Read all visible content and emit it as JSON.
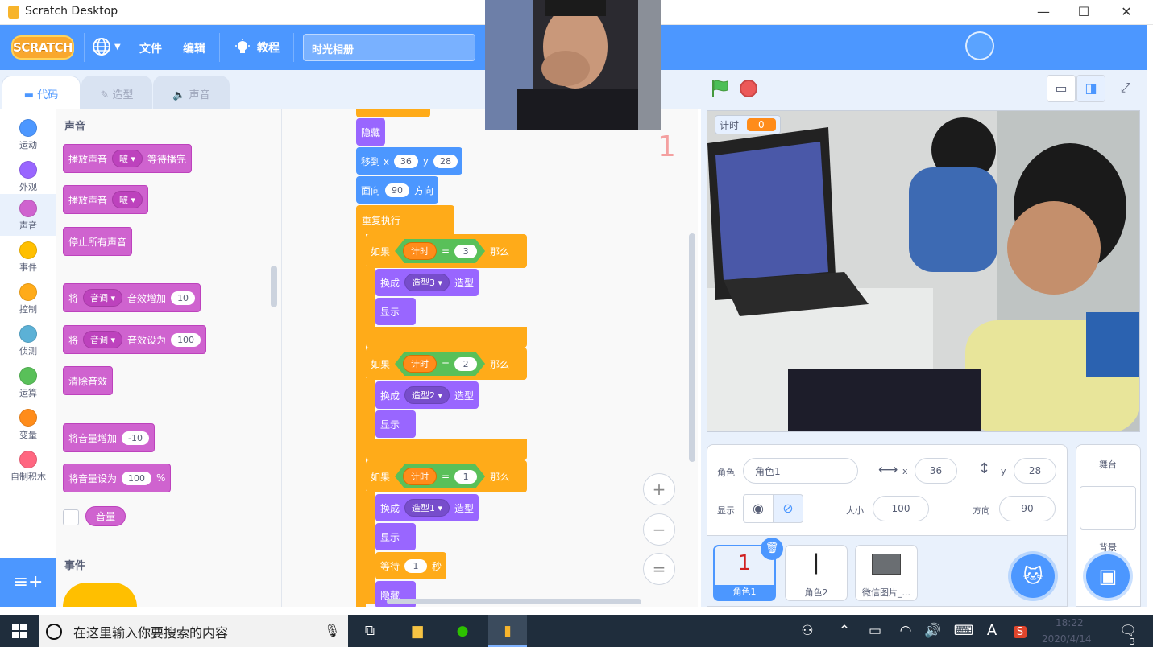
{
  "window": {
    "title": "Scratch Desktop",
    "minimize": "—",
    "maximize": "☐",
    "close": "✕"
  },
  "menubar": {
    "logo": "SCRATCH",
    "language_icon": "globe-icon",
    "file": "文件",
    "edit": "编辑",
    "tutorials": "教程",
    "project_title": "时光相册"
  },
  "tabs": {
    "code": "代码",
    "costumes": "造型",
    "sounds": "声音"
  },
  "categories": [
    {
      "label": "运动",
      "color": "#4c97ff"
    },
    {
      "label": "外观",
      "color": "#9966ff"
    },
    {
      "label": "声音",
      "color": "#cf63cf"
    },
    {
      "label": "事件",
      "color": "#ffbf00"
    },
    {
      "label": "控制",
      "color": "#ffab19"
    },
    {
      "label": "侦测",
      "color": "#5cb1d6"
    },
    {
      "label": "运算",
      "color": "#59c059"
    },
    {
      "label": "变量",
      "color": "#ff8c1a"
    },
    {
      "label": "自制积木",
      "color": "#ff6680"
    }
  ],
  "palette": {
    "sound_heading": "声音",
    "play_until_done": {
      "text1": "播放声音",
      "sound": "啵",
      "text2": "等待播完"
    },
    "start_sound": {
      "text1": "播放声音",
      "sound": "啵"
    },
    "stop_all": "停止所有声音",
    "change_effect": {
      "text1": "将",
      "effect": "音调",
      "text2": "音效增加",
      "value": "10"
    },
    "set_effect": {
      "text1": "将",
      "effect": "音调",
      "text2": "音效设为",
      "value": "100"
    },
    "clear_effects": "清除音效",
    "change_volume": {
      "text": "将音量增加",
      "value": "-10"
    },
    "set_volume": {
      "text": "将音量设为",
      "value": "100",
      "unit": "%"
    },
    "volume_reporter": "音量",
    "events_heading": "事件"
  },
  "script": {
    "hide1": "隐藏",
    "goto": {
      "text": "移到 x",
      "x": "36",
      "ylabel": "y",
      "y": "28"
    },
    "point": {
      "text": "面向",
      "value": "90",
      "unit": "方向"
    },
    "forever": "重复执行",
    "if_blocks": [
      {
        "if": "如果",
        "var": "计时",
        "op": "=",
        "value": "3",
        "then": "那么",
        "switch": "换成",
        "costume": "造型3",
        "costume_label": "造型",
        "show": "显示"
      },
      {
        "if": "如果",
        "var": "计时",
        "op": "=",
        "value": "2",
        "then": "那么",
        "switch": "换成",
        "costume": "造型2",
        "costume_label": "造型",
        "show": "显示"
      },
      {
        "if": "如果",
        "var": "计时",
        "op": "=",
        "value": "1",
        "then": "那么",
        "switch": "换成",
        "costume": "造型1",
        "costume_label": "造型",
        "show": "显示"
      }
    ],
    "wait": {
      "text": "等待",
      "value": "1",
      "unit": "秒"
    },
    "hide2": "隐藏",
    "sprite_thumb_number": "1",
    "zoom_in": "+",
    "zoom_out": "−",
    "zoom_reset": "="
  },
  "stage": {
    "monitor_label": "计时",
    "monitor_value": "0"
  },
  "sprite_info": {
    "sprite_label": "角色",
    "sprite_name": "角色1",
    "x_label": "x",
    "x": "36",
    "y_label": "y",
    "y": "28",
    "show_label": "显示",
    "size_label": "大小",
    "size": "100",
    "direction_label": "方向",
    "direction": "90"
  },
  "sprites": [
    {
      "name": "角色1",
      "glyph": "1"
    },
    {
      "name": "角色2",
      "glyph": "|"
    },
    {
      "name": "微信图片_..."
    }
  ],
  "stage_pane": {
    "title": "舞台",
    "backdrops": "背景"
  },
  "taskbar": {
    "search_placeholder": "在这里输入你要搜索的内容",
    "time": "18:22",
    "date": "2020/4/14",
    "ime": "A",
    "notifications": "3"
  }
}
